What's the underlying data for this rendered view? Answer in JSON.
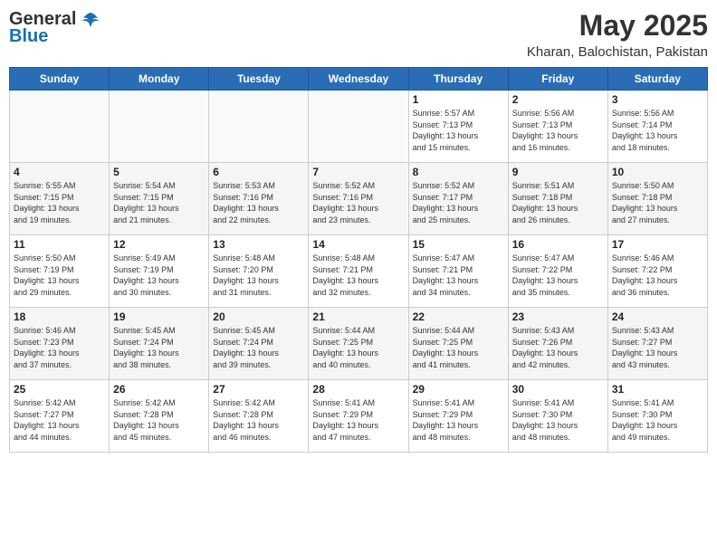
{
  "header": {
    "logo_general": "General",
    "logo_blue": "Blue",
    "title": "May 2025",
    "subtitle": "Kharan, Balochistan, Pakistan"
  },
  "days_of_week": [
    "Sunday",
    "Monday",
    "Tuesday",
    "Wednesday",
    "Thursday",
    "Friday",
    "Saturday"
  ],
  "weeks": [
    [
      {
        "day": "",
        "info": ""
      },
      {
        "day": "",
        "info": ""
      },
      {
        "day": "",
        "info": ""
      },
      {
        "day": "",
        "info": ""
      },
      {
        "day": "1",
        "info": "Sunrise: 5:57 AM\nSunset: 7:13 PM\nDaylight: 13 hours\nand 15 minutes."
      },
      {
        "day": "2",
        "info": "Sunrise: 5:56 AM\nSunset: 7:13 PM\nDaylight: 13 hours\nand 16 minutes."
      },
      {
        "day": "3",
        "info": "Sunrise: 5:56 AM\nSunset: 7:14 PM\nDaylight: 13 hours\nand 18 minutes."
      }
    ],
    [
      {
        "day": "4",
        "info": "Sunrise: 5:55 AM\nSunset: 7:15 PM\nDaylight: 13 hours\nand 19 minutes."
      },
      {
        "day": "5",
        "info": "Sunrise: 5:54 AM\nSunset: 7:15 PM\nDaylight: 13 hours\nand 21 minutes."
      },
      {
        "day": "6",
        "info": "Sunrise: 5:53 AM\nSunset: 7:16 PM\nDaylight: 13 hours\nand 22 minutes."
      },
      {
        "day": "7",
        "info": "Sunrise: 5:52 AM\nSunset: 7:16 PM\nDaylight: 13 hours\nand 23 minutes."
      },
      {
        "day": "8",
        "info": "Sunrise: 5:52 AM\nSunset: 7:17 PM\nDaylight: 13 hours\nand 25 minutes."
      },
      {
        "day": "9",
        "info": "Sunrise: 5:51 AM\nSunset: 7:18 PM\nDaylight: 13 hours\nand 26 minutes."
      },
      {
        "day": "10",
        "info": "Sunrise: 5:50 AM\nSunset: 7:18 PM\nDaylight: 13 hours\nand 27 minutes."
      }
    ],
    [
      {
        "day": "11",
        "info": "Sunrise: 5:50 AM\nSunset: 7:19 PM\nDaylight: 13 hours\nand 29 minutes."
      },
      {
        "day": "12",
        "info": "Sunrise: 5:49 AM\nSunset: 7:19 PM\nDaylight: 13 hours\nand 30 minutes."
      },
      {
        "day": "13",
        "info": "Sunrise: 5:48 AM\nSunset: 7:20 PM\nDaylight: 13 hours\nand 31 minutes."
      },
      {
        "day": "14",
        "info": "Sunrise: 5:48 AM\nSunset: 7:21 PM\nDaylight: 13 hours\nand 32 minutes."
      },
      {
        "day": "15",
        "info": "Sunrise: 5:47 AM\nSunset: 7:21 PM\nDaylight: 13 hours\nand 34 minutes."
      },
      {
        "day": "16",
        "info": "Sunrise: 5:47 AM\nSunset: 7:22 PM\nDaylight: 13 hours\nand 35 minutes."
      },
      {
        "day": "17",
        "info": "Sunrise: 5:46 AM\nSunset: 7:22 PM\nDaylight: 13 hours\nand 36 minutes."
      }
    ],
    [
      {
        "day": "18",
        "info": "Sunrise: 5:46 AM\nSunset: 7:23 PM\nDaylight: 13 hours\nand 37 minutes."
      },
      {
        "day": "19",
        "info": "Sunrise: 5:45 AM\nSunset: 7:24 PM\nDaylight: 13 hours\nand 38 minutes."
      },
      {
        "day": "20",
        "info": "Sunrise: 5:45 AM\nSunset: 7:24 PM\nDaylight: 13 hours\nand 39 minutes."
      },
      {
        "day": "21",
        "info": "Sunrise: 5:44 AM\nSunset: 7:25 PM\nDaylight: 13 hours\nand 40 minutes."
      },
      {
        "day": "22",
        "info": "Sunrise: 5:44 AM\nSunset: 7:25 PM\nDaylight: 13 hours\nand 41 minutes."
      },
      {
        "day": "23",
        "info": "Sunrise: 5:43 AM\nSunset: 7:26 PM\nDaylight: 13 hours\nand 42 minutes."
      },
      {
        "day": "24",
        "info": "Sunrise: 5:43 AM\nSunset: 7:27 PM\nDaylight: 13 hours\nand 43 minutes."
      }
    ],
    [
      {
        "day": "25",
        "info": "Sunrise: 5:42 AM\nSunset: 7:27 PM\nDaylight: 13 hours\nand 44 minutes."
      },
      {
        "day": "26",
        "info": "Sunrise: 5:42 AM\nSunset: 7:28 PM\nDaylight: 13 hours\nand 45 minutes."
      },
      {
        "day": "27",
        "info": "Sunrise: 5:42 AM\nSunset: 7:28 PM\nDaylight: 13 hours\nand 46 minutes."
      },
      {
        "day": "28",
        "info": "Sunrise: 5:41 AM\nSunset: 7:29 PM\nDaylight: 13 hours\nand 47 minutes."
      },
      {
        "day": "29",
        "info": "Sunrise: 5:41 AM\nSunset: 7:29 PM\nDaylight: 13 hours\nand 48 minutes."
      },
      {
        "day": "30",
        "info": "Sunrise: 5:41 AM\nSunset: 7:30 PM\nDaylight: 13 hours\nand 48 minutes."
      },
      {
        "day": "31",
        "info": "Sunrise: 5:41 AM\nSunset: 7:30 PM\nDaylight: 13 hours\nand 49 minutes."
      }
    ]
  ]
}
